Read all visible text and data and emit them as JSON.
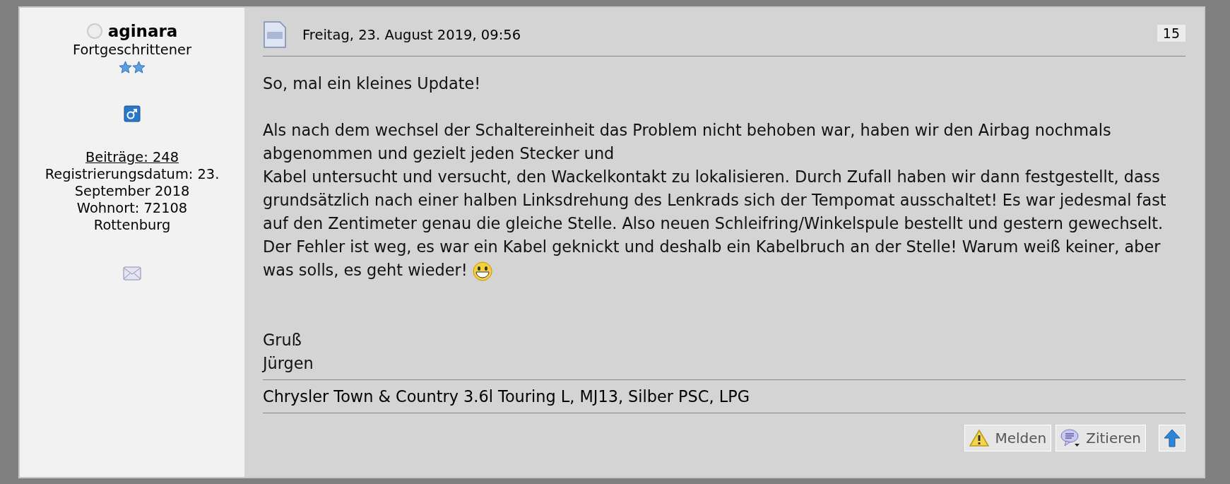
{
  "author": {
    "name": "aginara",
    "online": false,
    "rank": "Fortgeschrittener",
    "rank_icons": [
      {
        "kind": "star"
      },
      {
        "kind": "star"
      }
    ],
    "posts": "Beiträge: 248",
    "details": [
      "Registrierungsdatum: 23. September 2018",
      "Wohnort: 72108 Rottenburg"
    ]
  },
  "post": {
    "date": "Freitag, 23. August 2019, 09:56",
    "number": "15",
    "paragraphs": [
      [
        "So, mal ein kleines Update!"
      ],
      [
        "Als nach dem wechsel der Schaltereinheit das Problem nicht behoben war, haben wir den Airbag nochmals abgenommen und gezielt jeden Stecker und",
        "Kabel untersucht und versucht, den Wackelkontakt zu lokalisieren. Durch Zufall haben wir dann festgestellt, dass grundsätzlich nach einer halben Linksdrehung des Lenkrads sich der Tempomat ausschaltet! Es war jedesmal fast auf den Zentimeter genau die gleiche Stelle. Also neuen Schleifring/Winkelspule bestellt und gestern gewechselt. Der Fehler ist weg, es war ein Kabel geknickt und deshalb ein Kabelbruch an der Stelle! Warum weiß keiner, aber was solls, es geht wieder!"
      ]
    ],
    "signoff": [
      "Gruß",
      "Jürgen"
    ],
    "signature": "Chrysler Town & Country 3.6l Touring L, MJ13, Silber PSC, LPG",
    "buttons": [
      {
        "kind": "report",
        "label": "Melden"
      },
      {
        "kind": "quote",
        "label": "Zitieren"
      },
      {
        "kind": "top"
      }
    ]
  }
}
